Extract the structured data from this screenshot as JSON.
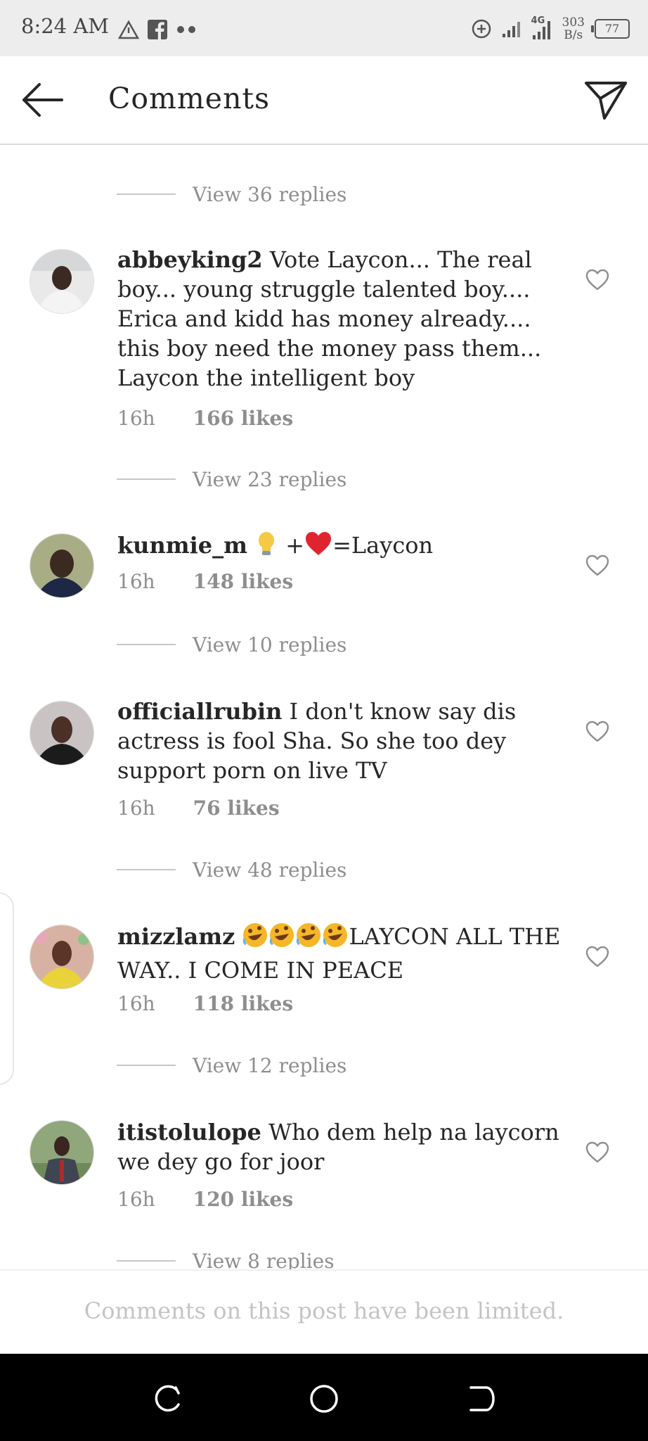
{
  "status_bar": {
    "time": "8:24 AM",
    "net_speed_value": "303",
    "net_speed_unit": "B/s",
    "network_type": "4G",
    "battery": "77",
    "icons": [
      "warning-icon",
      "facebook-icon",
      "more-dots-icon",
      "data-saver-icon",
      "signal-icon",
      "signal-4g-icon",
      "battery-icon"
    ]
  },
  "header": {
    "title": "Comments",
    "icons": [
      "back-arrow-icon",
      "send-icon"
    ]
  },
  "comments": [
    {
      "view_replies": "View 36 replies"
    },
    {
      "username": "abbeyking2",
      "text": "Vote Laycon... The real boy... young struggle talented boy.... Erica and kidd has money already.... this boy need the money pass them... Laycon the intelligent boy",
      "time": "16h",
      "likes": "166 likes",
      "view_replies": "View 23 replies"
    },
    {
      "username": "kunmie_m",
      "text_after": "=Laycon",
      "emoji": [
        "light-bulb-icon",
        "red-heart-icon"
      ],
      "plus": "+",
      "time": "16h",
      "likes": "148 likes",
      "view_replies": "View 10 replies"
    },
    {
      "username": "officiallrubin",
      "text": "I don't know say dis actress is fool Sha. So she too dey support porn on live TV",
      "time": "16h",
      "likes": "76 likes",
      "view_replies": "View 48 replies"
    },
    {
      "username": "mizzlamz",
      "emoji": [
        "rolling-laughing-icon",
        "rolling-laughing-icon",
        "rolling-laughing-icon",
        "rolling-laughing-icon"
      ],
      "text": "LAYCON ALL THE WAY.. I COME IN PEACE",
      "time": "16h",
      "likes": "118 likes",
      "view_replies": "View 12 replies"
    },
    {
      "username": "itistolulope",
      "text": "Who dem help na laycorn we dey go for joor",
      "time": "16h",
      "likes": "120 likes",
      "view_replies": "View 8 replies"
    }
  ],
  "footer": {
    "limited_text": "Comments on this post have been limited."
  },
  "nav_bar": {
    "icons": [
      "recent-apps-icon",
      "home-circle-icon",
      "back-icon"
    ]
  },
  "colors": {
    "text": "#262626",
    "muted": "#8e8e8e",
    "divider": "#dbdbdb",
    "status_bg": "#ededed",
    "nav_bg": "#000000"
  }
}
